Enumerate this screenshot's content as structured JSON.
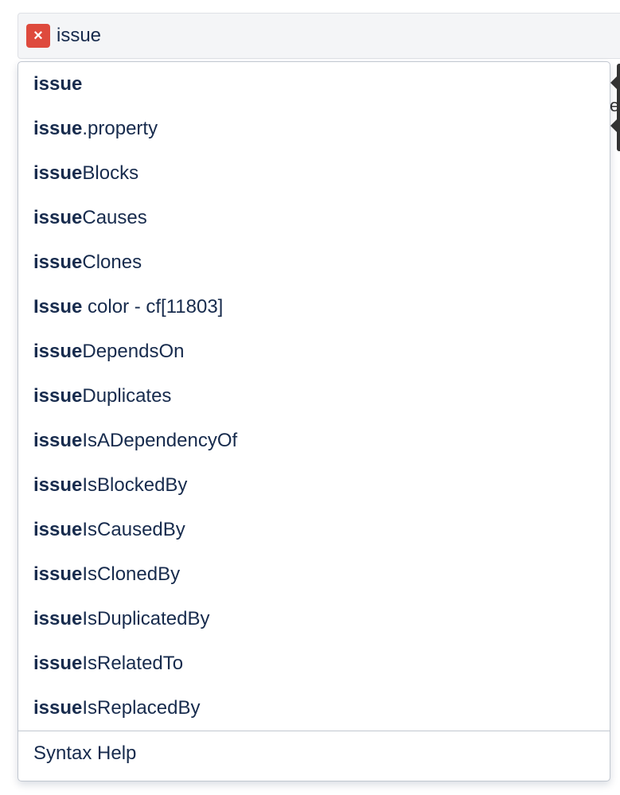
{
  "search": {
    "query": "issue",
    "error_icon": "x-error-icon"
  },
  "side_tooltip": {
    "partial_text": "e"
  },
  "suggestions": [
    {
      "match": "issue",
      "rest": ""
    },
    {
      "match": "issue",
      "rest": ".property"
    },
    {
      "match": "issue",
      "rest": "Blocks"
    },
    {
      "match": "issue",
      "rest": "Causes"
    },
    {
      "match": "issue",
      "rest": "Clones"
    },
    {
      "match": "Issue",
      "rest": " color - cf[11803]"
    },
    {
      "match": "issue",
      "rest": "DependsOn"
    },
    {
      "match": "issue",
      "rest": "Duplicates"
    },
    {
      "match": "issue",
      "rest": "IsADependencyOf"
    },
    {
      "match": "issue",
      "rest": "IsBlockedBy"
    },
    {
      "match": "issue",
      "rest": "IsCausedBy"
    },
    {
      "match": "issue",
      "rest": "IsClonedBy"
    },
    {
      "match": "issue",
      "rest": "IsDuplicatedBy"
    },
    {
      "match": "issue",
      "rest": "IsRelatedTo"
    },
    {
      "match": "issue",
      "rest": "IsReplacedBy"
    }
  ],
  "footer": {
    "syntax_help": "Syntax Help"
  },
  "colors": {
    "error": "#de4a3d",
    "text": "#172b4d",
    "input_bg": "#f4f5f7"
  }
}
